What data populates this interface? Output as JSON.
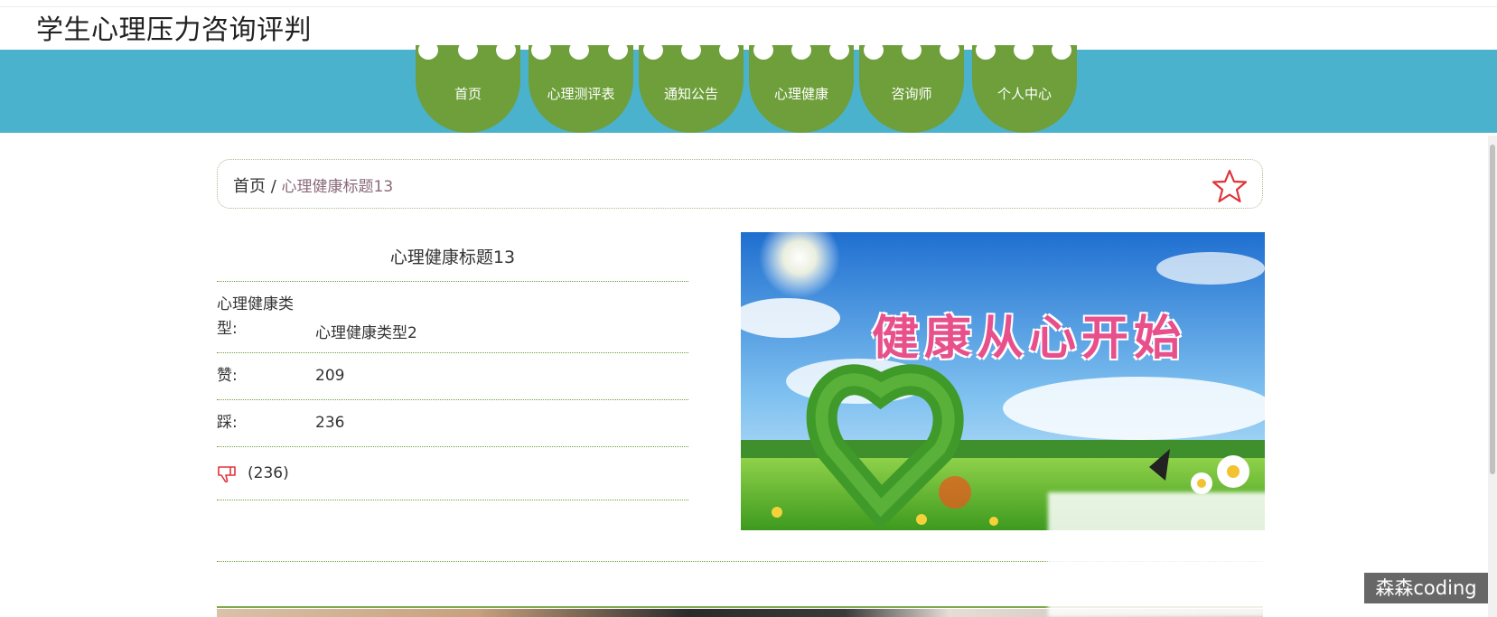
{
  "site": {
    "title": "学生心理压力咨询评判"
  },
  "nav": {
    "items": [
      {
        "label": "首页"
      },
      {
        "label": "心理测评表"
      },
      {
        "label": "通知公告"
      },
      {
        "label": "心理健康"
      },
      {
        "label": "咨询师"
      },
      {
        "label": "个人中心"
      }
    ]
  },
  "breadcrumb": {
    "home": "首页",
    "separator": "/",
    "current": "心理健康标题13"
  },
  "detail": {
    "title": "心理健康标题13",
    "fields": [
      {
        "label": "心理健康类型:",
        "value": "心理健康类型2"
      },
      {
        "label": "赞:",
        "value": "209"
      },
      {
        "label": "踩:",
        "value": "236"
      }
    ],
    "dislike_count": "(236)"
  },
  "banner": {
    "text": "健康从心开始"
  },
  "watermark": "森森coding",
  "colors": {
    "nav_bg": "#4bb2cd",
    "nav_item": "#6e9f3b",
    "accent_red": "#e0333a"
  }
}
